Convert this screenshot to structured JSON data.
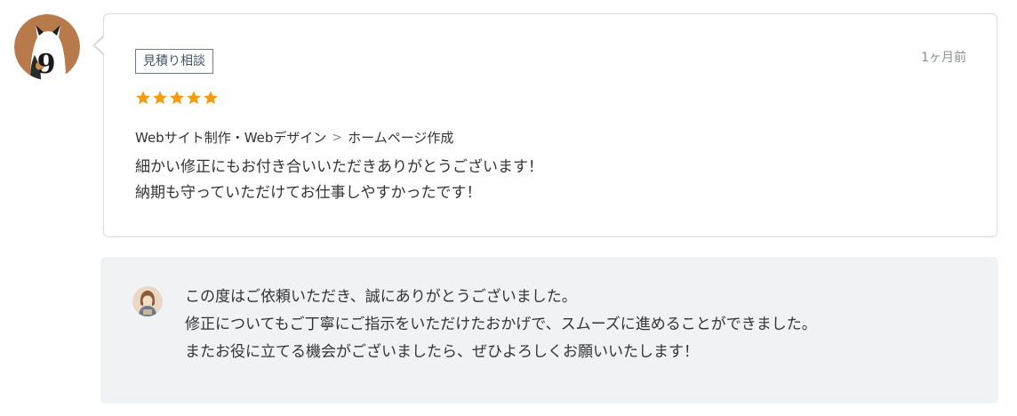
{
  "review": {
    "tag_label": "見積り相談",
    "date": "1ヶ月前",
    "rating": 5,
    "star_color": "#f39c12",
    "category": {
      "parent": "Webサイト制作・Webデザイン",
      "separator": ">",
      "child": "ホームページ作成"
    },
    "lines": [
      "細かい修正にもお付き合いいただきありがとうございます！",
      "納期も守っていただけてお仕事しやすかったです！"
    ],
    "avatar_icon": "cat-number-9-avatar"
  },
  "reply": {
    "avatar_icon": "seller-avatar",
    "lines": [
      "この度はご依頼いただき、誠にありがとうございました。",
      "修正についてもご丁寧にご指示をいただけたおかげで、スムーズに進めることができました。",
      "またお役に立てる機会がございましたら、ぜひよろしくお願いいたします！"
    ]
  }
}
